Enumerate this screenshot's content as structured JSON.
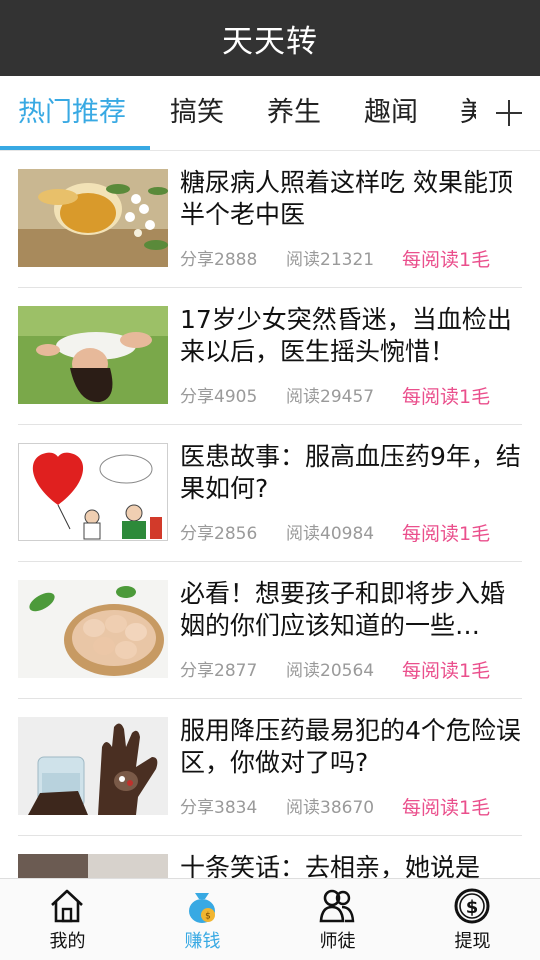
{
  "app": {
    "title": "天天转"
  },
  "tabs": [
    {
      "label": "热门推荐",
      "active": true
    },
    {
      "label": "搞笑"
    },
    {
      "label": "养生"
    },
    {
      "label": "趣闻"
    },
    {
      "label": "美"
    }
  ],
  "tab_more_icon": "plus-icon",
  "articles": [
    {
      "title": "糖尿病人照着这样吃 效果能顶半个老中医",
      "share": "分享2888",
      "read": "阅读21321",
      "reward": "每阅读1毛",
      "thumb": "honey-flowers"
    },
    {
      "title": "17岁少女突然昏迷，当血检出来以后，医生摇头惋惜！",
      "share": "分享4905",
      "read": "阅读29457",
      "reward": "每阅读1毛",
      "thumb": "girl-on-grass"
    },
    {
      "title": "医患故事：服高血压药9年，结果如何?",
      "share": "分享2856",
      "read": "阅读40984",
      "reward": "每阅读1毛",
      "thumb": "heart-balloon-cartoon"
    },
    {
      "title": "必看！想要孩子和即将步入婚姻的你们应该知道的一些…",
      "share": "分享2877",
      "read": "阅读20564",
      "reward": "每阅读1毛",
      "thumb": "eggs-basket"
    },
    {
      "title": "服用降压药最易犯的4个危险误区，你做对了吗?",
      "share": "分享3834",
      "read": "阅读38670",
      "reward": "每阅读1毛",
      "thumb": "hand-pills-water"
    },
    {
      "title": "十条笑话：去相亲，她说是",
      "share": "",
      "read": "",
      "reward": "",
      "thumb": "partial"
    }
  ],
  "bottom_nav": [
    {
      "label": "我的",
      "icon": "home-icon"
    },
    {
      "label": "赚钱",
      "icon": "money-bag-icon",
      "active": true
    },
    {
      "label": "师徒",
      "icon": "users-icon"
    },
    {
      "label": "提现",
      "icon": "dollar-coin-icon"
    }
  ],
  "colors": {
    "accent": "#38a9e3",
    "reward": "#ea4f8c",
    "titlebar": "#333333"
  }
}
